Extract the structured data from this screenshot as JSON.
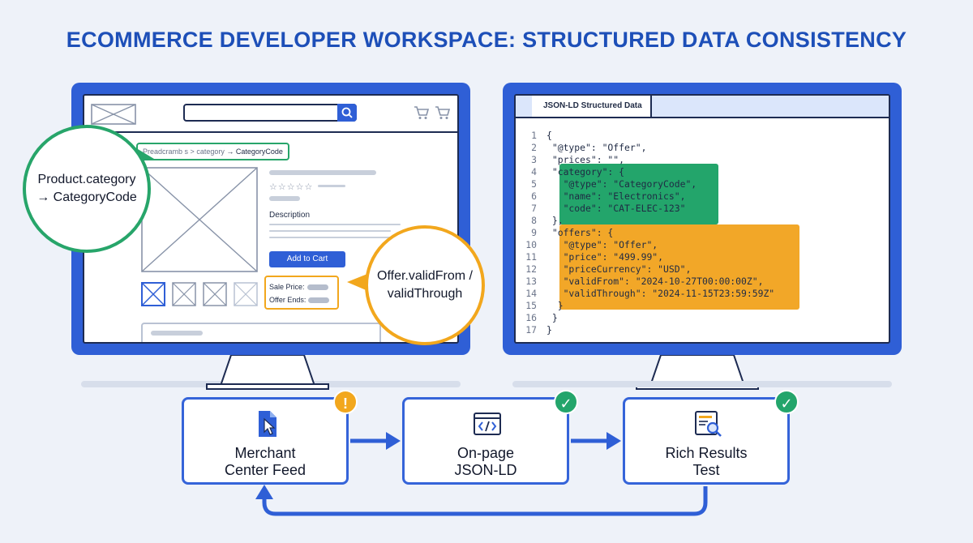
{
  "title": "ECOMMERCE DEVELOPER WORKSPACE: STRUCTURED DATA CONSISTENCY",
  "colors": {
    "brand_blue": "#2f5fd6",
    "title_blue": "#1d4fb8",
    "success_green": "#23a56b",
    "warning_orange": "#f2a71d"
  },
  "browser": {
    "logo_icon": "image-placeholder-icon",
    "search_icon": "search-icon",
    "cart_icon": "cart-icon",
    "breadcrumb": {
      "part1": "Preadcramb s",
      "sep": ">",
      "part2": "category",
      "arrow": "→",
      "current": "CategoryCode"
    },
    "stars": "☆☆☆☆☆",
    "description_label": "Description",
    "add_to_cart": "Add to Cart",
    "sale_price_label": "Sale Price:",
    "offer_ends_label": "Offer Ends:"
  },
  "callouts": {
    "category": {
      "line1": "Product.category",
      "line2": "→ CategoryCode"
    },
    "offer": {
      "line1": "Offer.validFrom /",
      "line2": "validThrough"
    }
  },
  "json_panel": {
    "tab_label": "JSON-LD Structured Data",
    "lines": [
      {
        "n": "1",
        "text": "{"
      },
      {
        "n": "2",
        "text": " \"@type\": \"Offer\","
      },
      {
        "n": "3",
        "text": " \"prices\": \"\","
      },
      {
        "n": "4",
        "text": " \"category\": {"
      },
      {
        "n": "5",
        "text": "   \"@type\": \"CategoryCode\","
      },
      {
        "n": "6",
        "text": "   \"name\": \"Electronics\","
      },
      {
        "n": "7",
        "text": "   \"code\": \"CAT-ELEC-123\""
      },
      {
        "n": "8",
        "text": " },"
      },
      {
        "n": "9",
        "text": " \"offers\": {"
      },
      {
        "n": "10",
        "text": "   \"@type\": \"Offer\","
      },
      {
        "n": "11",
        "text": "   \"price\": \"499.99\","
      },
      {
        "n": "12",
        "text": "   \"priceCurrency\": \"USD\","
      },
      {
        "n": "13",
        "text": "   \"validFrom\": \"2024-10-27T00:00:00Z\","
      },
      {
        "n": "14",
        "text": "   \"validThrough\": \"2024-11-15T23:59:59Z\""
      },
      {
        "n": "15",
        "text": "  }"
      },
      {
        "n": "16",
        "text": " }"
      },
      {
        "n": "17",
        "text": "}"
      }
    ]
  },
  "flow": {
    "merchant": {
      "line1": "Merchant",
      "line2": "Center Feed",
      "status": "!",
      "status_kind": "warning",
      "icon": "cursor-document-icon"
    },
    "jsonld": {
      "line1": "On-page",
      "line2": "JSON-LD",
      "status": "✓",
      "status_kind": "ok",
      "icon": "code-window-icon"
    },
    "rich": {
      "line1": "Rich Results",
      "line2": "Test",
      "status": "✓",
      "status_kind": "ok",
      "icon": "magnifier-document-icon"
    }
  }
}
